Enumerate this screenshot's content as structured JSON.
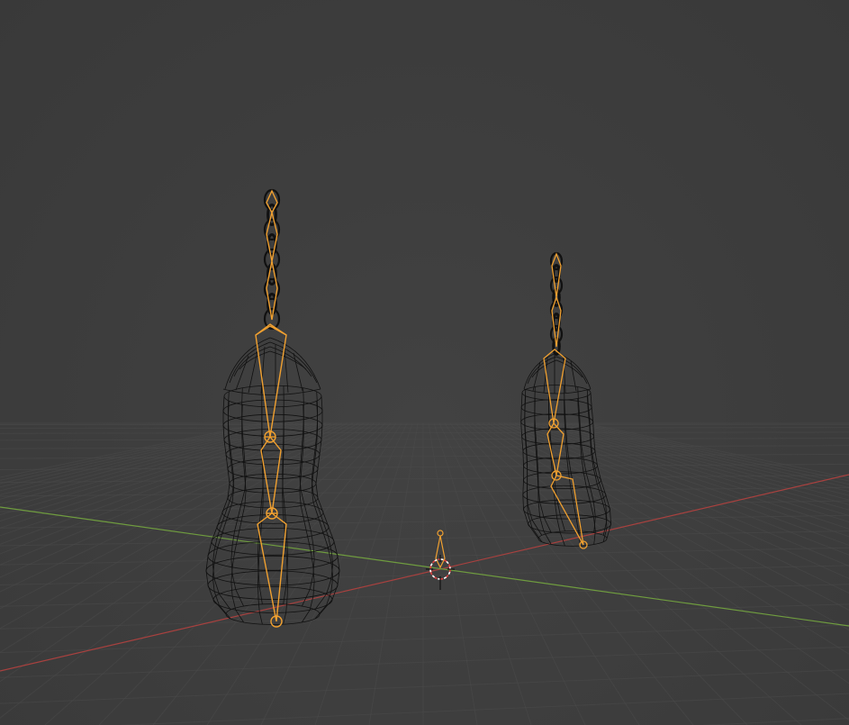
{
  "viewport": {
    "background": "#3d3d3d",
    "grid_color": "#4a4a4a",
    "x_axis_color": "#a8413f",
    "y_axis_color": "#6f9c3f",
    "wire_color": "#111111",
    "bone_color": "#f0a030",
    "cursor_color": "#e04040",
    "icons": [
      "3d-cursor-icon",
      "light-empty-icon"
    ]
  },
  "scene": {
    "objects": [
      "large-punching-bag",
      "small-punching-bag"
    ]
  }
}
